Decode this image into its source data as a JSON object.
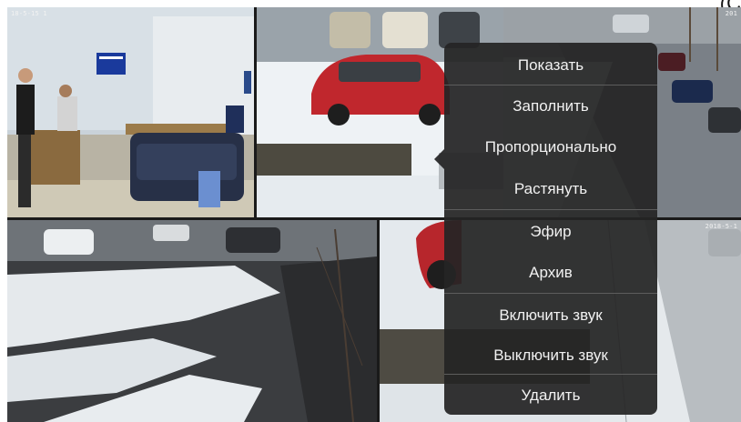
{
  "corner_text": "(C",
  "cameras": [
    {
      "timestamp": "18-5-15 1"
    },
    {
      "timestamp": ""
    },
    {
      "timestamp": "201"
    },
    {
      "timestamp": ""
    },
    {
      "timestamp": ""
    },
    {
      "timestamp": "2018-5-1"
    }
  ],
  "context_menu": {
    "items": [
      {
        "label": "Показать"
      },
      {
        "label": "Заполнить"
      },
      {
        "label": "Пропорционально"
      },
      {
        "label": "Растянуть"
      },
      {
        "label": "Эфир"
      },
      {
        "label": "Архив"
      },
      {
        "label": "Включить звук"
      },
      {
        "label": "Выключить звук"
      },
      {
        "label": "Удалить"
      }
    ]
  },
  "colors": {
    "selection_border": "#1f6fd6",
    "menu_background": "#252525",
    "menu_text": "#f1f1f1"
  }
}
